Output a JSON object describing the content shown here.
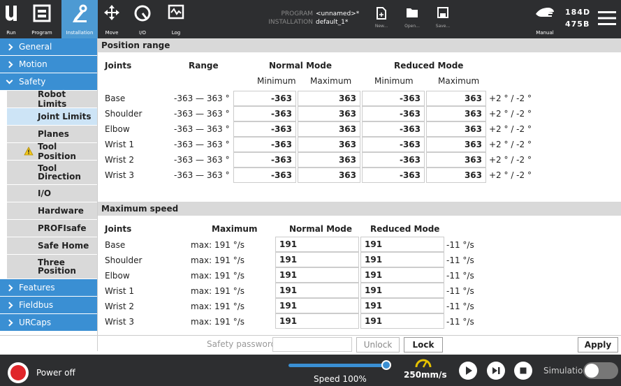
{
  "top": {
    "nav": [
      {
        "label": "Run",
        "icon": "run-icon"
      },
      {
        "label": "Program",
        "icon": "program-icon"
      },
      {
        "label": "Installation",
        "icon": "installation-icon"
      },
      {
        "label": "Move",
        "icon": "move-icon"
      },
      {
        "label": "I/O",
        "icon": "io-icon"
      },
      {
        "label": "Log",
        "icon": "log-icon"
      }
    ],
    "program_key": "PROGRAM",
    "program_val": "<unnamed>*",
    "install_key": "INSTALLATION",
    "install_val": "default_1*",
    "file": [
      "New...",
      "Open...",
      "Save..."
    ],
    "mode": "Manual",
    "id1": "184D",
    "id2": "475B"
  },
  "sidebar": {
    "general": "General",
    "motion": "Motion",
    "safety": "Safety",
    "safety_items": [
      "Robot Limits",
      "Joint Limits",
      "Planes",
      "Tool Position",
      "Tool Direction",
      "I/O",
      "Hardware",
      "PROFIsafe",
      "Safe Home",
      "Three Position"
    ],
    "features": "Features",
    "fieldbus": "Fieldbus",
    "urcaps": "URCaps"
  },
  "position": {
    "title": "Position range",
    "h_joints": "Joints",
    "h_range": "Range",
    "h_normal": "Normal Mode",
    "h_reduced": "Reduced Mode",
    "minimum": "Minimum",
    "maximum": "Maximum",
    "rows": [
      {
        "joint": "Base",
        "range": "-363 — 363 °",
        "nmin": "-363",
        "nmax": "363",
        "rmin": "-363",
        "rmax": "363",
        "tol": "+2 ° / -2 °"
      },
      {
        "joint": "Shoulder",
        "range": "-363 — 363 °",
        "nmin": "-363",
        "nmax": "363",
        "rmin": "-363",
        "rmax": "363",
        "tol": "+2 ° / -2 °"
      },
      {
        "joint": "Elbow",
        "range": "-363 — 363 °",
        "nmin": "-363",
        "nmax": "363",
        "rmin": "-363",
        "rmax": "363",
        "tol": "+2 ° / -2 °"
      },
      {
        "joint": "Wrist 1",
        "range": "-363 — 363 °",
        "nmin": "-363",
        "nmax": "363",
        "rmin": "-363",
        "rmax": "363",
        "tol": "+2 ° / -2 °"
      },
      {
        "joint": "Wrist 2",
        "range": "-363 — 363 °",
        "nmin": "-363",
        "nmax": "363",
        "rmin": "-363",
        "rmax": "363",
        "tol": "+2 ° / -2 °"
      },
      {
        "joint": "Wrist 3",
        "range": "-363 — 363 °",
        "nmin": "-363",
        "nmax": "363",
        "rmin": "-363",
        "rmax": "363",
        "tol": "+2 ° / -2 °"
      }
    ]
  },
  "speed": {
    "title": "Maximum speed",
    "h_joints": "Joints",
    "h_max": "Maximum",
    "h_normal": "Normal Mode",
    "h_reduced": "Reduced Mode",
    "rows": [
      {
        "joint": "Base",
        "max": "max: 191 °/s",
        "normal": "191",
        "reduced": "191",
        "tol": "-11 °/s"
      },
      {
        "joint": "Shoulder",
        "max": "max: 191 °/s",
        "normal": "191",
        "reduced": "191",
        "tol": "-11 °/s"
      },
      {
        "joint": "Elbow",
        "max": "max: 191 °/s",
        "normal": "191",
        "reduced": "191",
        "tol": "-11 °/s"
      },
      {
        "joint": "Wrist 1",
        "max": "max: 191 °/s",
        "normal": "191",
        "reduced": "191",
        "tol": "-11 °/s"
      },
      {
        "joint": "Wrist 2",
        "max": "max: 191 °/s",
        "normal": "191",
        "reduced": "191",
        "tol": "-11 °/s"
      },
      {
        "joint": "Wrist 3",
        "max": "max: 191 °/s",
        "normal": "191",
        "reduced": "191",
        "tol": "-11 °/s"
      }
    ]
  },
  "footer": {
    "pw_label": "Safety password",
    "pw_value": "",
    "unlock": "Unlock",
    "lock": "Lock",
    "apply": "Apply"
  },
  "status": {
    "power": "Power off",
    "speed_label": "Speed 100%",
    "speed_value": 1.0,
    "tcp_speed": "250mm/s",
    "simulation": "Simulation"
  },
  "colors": {
    "accent": "#3a8fd3",
    "dark": "#2d2e30",
    "power": "#e0252a"
  }
}
